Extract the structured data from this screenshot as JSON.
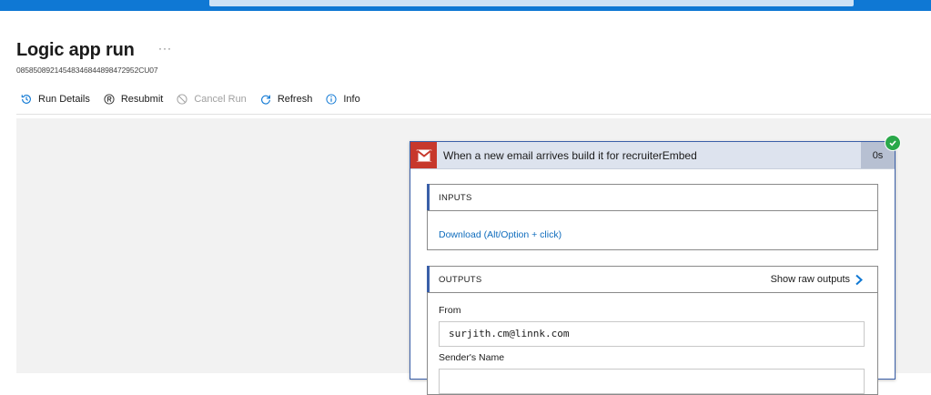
{
  "page": {
    "title": "Logic app run",
    "more": "···",
    "run_id": "08585089214548346844898472952CU07"
  },
  "toolbar": {
    "run_details": "Run Details",
    "resubmit": "Resubmit",
    "cancel_run": "Cancel Run",
    "refresh": "Refresh",
    "info": "Info"
  },
  "step": {
    "title": "When a new email arrives build it for recruiterEmbed",
    "duration": "0s",
    "status": "succeeded",
    "inputs": {
      "label": "INPUTS",
      "download_link": "Download (Alt/Option + click)"
    },
    "outputs": {
      "label": "OUTPUTS",
      "show_raw": "Show raw outputs",
      "fields": [
        {
          "label": "From",
          "value": "surjith.cm@linnk.com"
        },
        {
          "label": "Sender's Name",
          "value": ""
        }
      ]
    }
  },
  "colors": {
    "brand": "#0f78d4",
    "link": "#0f6cbd",
    "success": "#2aa84a",
    "gmail_red": "#c7382c",
    "card_border": "#3a5fa8"
  }
}
